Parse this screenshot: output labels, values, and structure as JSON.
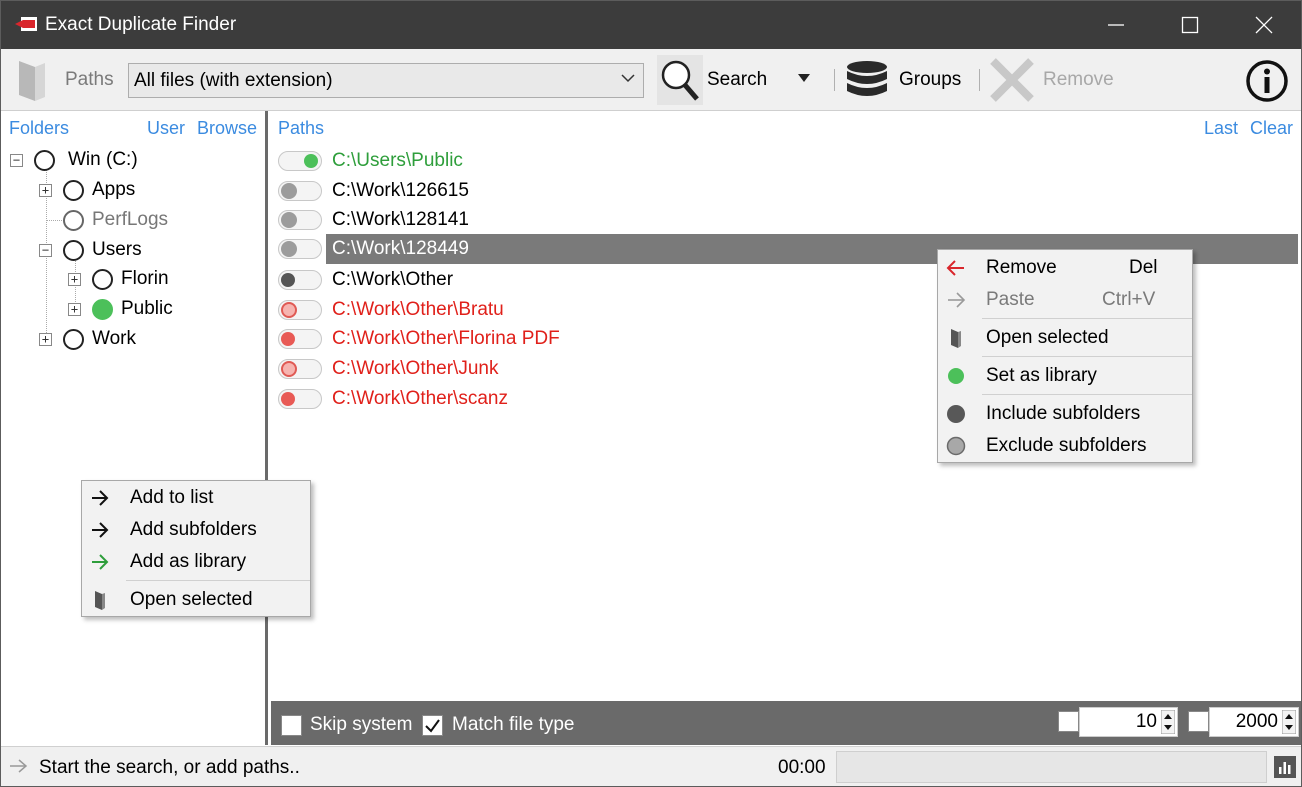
{
  "window": {
    "title": "Exact Duplicate Finder"
  },
  "toolbar": {
    "paths_label": "Paths",
    "filter_value": "All files (with extension)",
    "search_label": "Search",
    "groups_label": "Groups",
    "remove_label": "Remove"
  },
  "folders": {
    "header": "Folders",
    "user_link": "User",
    "browse_link": "Browse",
    "tree": [
      {
        "label": "Win (C:)",
        "state": "empty",
        "expander": "minus"
      },
      {
        "label": "Apps",
        "state": "empty",
        "expander": "plus"
      },
      {
        "label": "PerfLogs",
        "state": "empty-gray",
        "expander": "none"
      },
      {
        "label": "Users",
        "state": "empty",
        "expander": "minus"
      },
      {
        "label": "Florin",
        "state": "empty",
        "expander": "plus"
      },
      {
        "label": "Public",
        "state": "library",
        "expander": "plus"
      },
      {
        "label": "Work",
        "state": "empty",
        "expander": "plus"
      }
    ]
  },
  "paths": {
    "header": "Paths",
    "last_link": "Last",
    "clear_link": "Clear",
    "items": [
      {
        "path": "C:\\Users\\Public",
        "mode": "library",
        "color": "#2e9e3b"
      },
      {
        "path": "C:\\Work\\126615",
        "mode": "exclude",
        "color": "#000000"
      },
      {
        "path": "C:\\Work\\128141",
        "mode": "exclude",
        "color": "#000000"
      },
      {
        "path": "C:\\Work\\128449",
        "mode": "exclude",
        "color": "#ffffff",
        "selected": true
      },
      {
        "path": "C:\\Work\\Other",
        "mode": "include",
        "color": "#000000"
      },
      {
        "path": "C:\\Work\\Other\\Bratu",
        "mode": "excluded-red",
        "color": "#e0201a"
      },
      {
        "path": "C:\\Work\\Other\\Florina PDF",
        "mode": "included-red",
        "color": "#e0201a"
      },
      {
        "path": "C:\\Work\\Other\\Junk",
        "mode": "excluded-red",
        "color": "#e0201a"
      },
      {
        "path": "C:\\Work\\Other\\scanz",
        "mode": "included-red",
        "color": "#e0201a"
      }
    ]
  },
  "options": {
    "skip_system_label": "Skip system",
    "skip_system_checked": false,
    "match_type_label": "Match file type",
    "match_type_checked": true,
    "min_size": "10",
    "max_size": "2000"
  },
  "status": {
    "message": "Start the search, or add paths..",
    "time": "00:00"
  },
  "context_menu_paths": [
    {
      "label": "Remove",
      "shortcut": "Del",
      "icon": "arrow-left-red-icon"
    },
    {
      "label": "Paste",
      "shortcut": "Ctrl+V",
      "icon": "arrow-right-gray-icon",
      "disabled": true
    },
    {
      "label": "Open selected",
      "shortcut": "",
      "icon": "folder-icon"
    },
    {
      "label": "Set as library",
      "shortcut": "",
      "icon": "green-dot-icon"
    },
    {
      "label": "Include subfolders",
      "shortcut": "",
      "icon": "dark-dot-icon"
    },
    {
      "label": "Exclude subfolders",
      "shortcut": "",
      "icon": "gray-dot-icon"
    }
  ],
  "context_menu_folders": [
    {
      "label": "Add to list",
      "icon": "arrow-right-icon"
    },
    {
      "label": "Add subfolders",
      "icon": "arrow-right-icon"
    },
    {
      "label": "Add as library",
      "icon": "arrow-right-green-icon"
    },
    {
      "label": "Open selected",
      "icon": "folder-icon"
    }
  ],
  "colors": {
    "link_blue": "#3b8be0",
    "library_green": "#4cc05a",
    "red": "#e0201a",
    "titlebar": "#3c3c3c"
  }
}
